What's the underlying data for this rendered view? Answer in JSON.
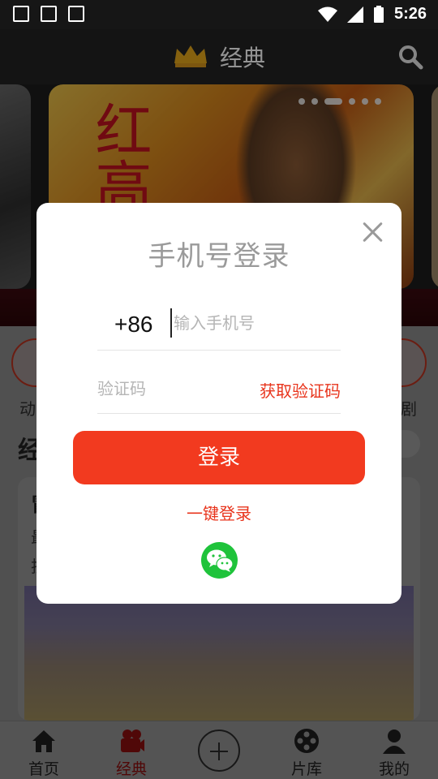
{
  "status_bar": {
    "time": "5:26"
  },
  "header": {
    "title": "经典",
    "crown_icon": "crown-icon",
    "search_icon": "search-icon"
  },
  "banner": {
    "poster_title_chars": "红高",
    "dots_count": 6,
    "active_dot": 2
  },
  "categories": {
    "left_label": "动",
    "right_label": "剧"
  },
  "section": {
    "title": "经"
  },
  "card": {
    "title": "冒",
    "line1": "最",
    "line2": "技"
  },
  "tabbar": {
    "tabs": [
      {
        "label": "首页",
        "icon": "home-icon"
      },
      {
        "label": "经典",
        "icon": "video-camera-icon",
        "active": true
      },
      {
        "label": "",
        "icon": "add-circle-icon"
      },
      {
        "label": "片库",
        "icon": "film-reel-icon"
      },
      {
        "label": "我的",
        "icon": "person-icon"
      }
    ]
  },
  "dialog": {
    "title": "手机号登录",
    "country_code": "+86",
    "phone_placeholder": "输入手机号",
    "code_placeholder": "验证码",
    "get_code_label": "获取验证码",
    "login_label": "登录",
    "one_key_label": "一键登录",
    "accent_color": "#F23A1F",
    "wechat_color": "#1FC33B"
  }
}
